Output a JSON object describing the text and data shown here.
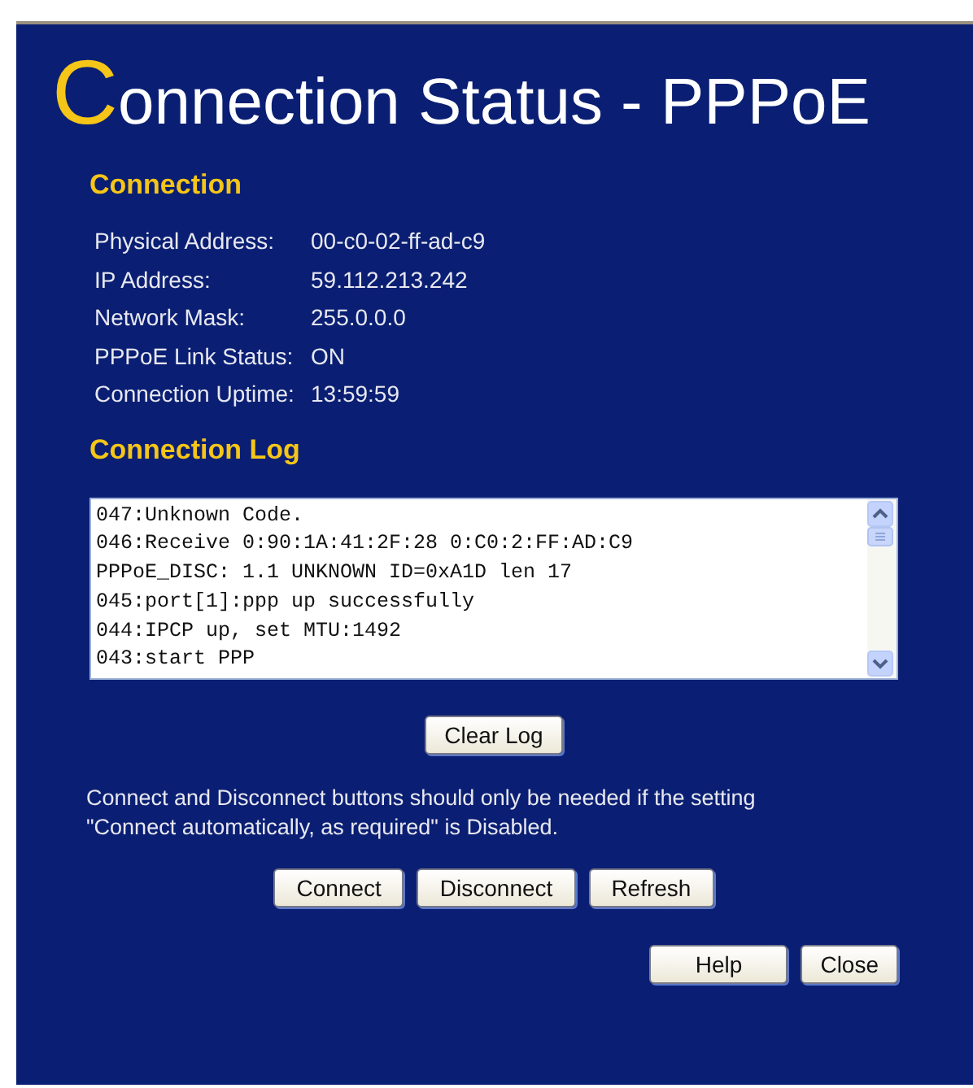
{
  "title": "Connection Status - PPPoE",
  "connection": {
    "heading": "Connection",
    "rows": [
      {
        "label": "Physical Address:",
        "value": "00-c0-02-ff-ad-c9"
      },
      {
        "label": "IP Address:",
        "value": "59.112.213.242"
      },
      {
        "label": "Network Mask:",
        "value": "255.0.0.0"
      },
      {
        "label": "PPPoE Link Status:",
        "value": "ON"
      },
      {
        "label": "Connection Uptime:",
        "value": "13:59:59"
      }
    ]
  },
  "log": {
    "heading": "Connection Log",
    "lines": [
      "047:Unknown Code.",
      "046:Receive 0:90:1A:41:2F:28 0:C0:2:FF:AD:C9",
      "PPPoE_DISC: 1.1 UNKNOWN ID=0xA1D len 17",
      "045:port[1]:ppp up successfully",
      "044:IPCP up, set MTU:1492",
      "043:start PPP"
    ],
    "clear_button": "Clear Log"
  },
  "note": "Connect and Disconnect buttons should only be needed if the setting \"Connect automatically, as required\" is Disabled.",
  "action_buttons": [
    "Connect",
    "Disconnect",
    "Refresh"
  ],
  "footer_buttons": [
    "Help",
    "Close"
  ]
}
